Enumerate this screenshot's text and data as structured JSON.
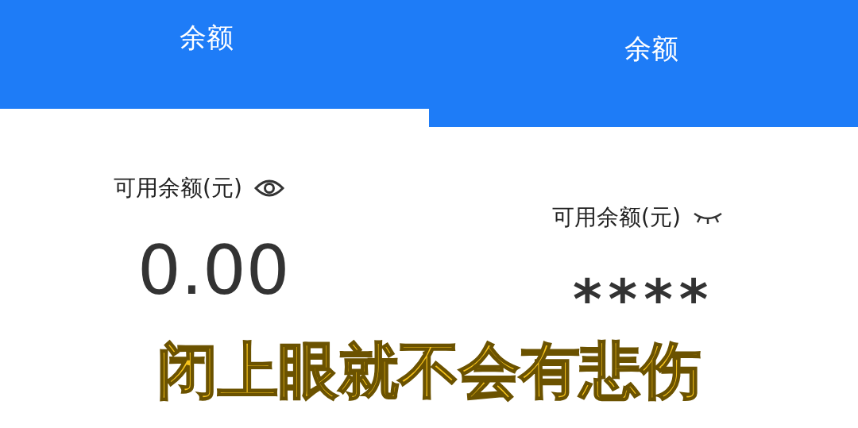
{
  "panels": [
    {
      "title": "余额",
      "balance_label": "可用余额(元)",
      "eye_open": true,
      "amount": "0.00"
    },
    {
      "title": "余额",
      "balance_label": "可用余额(元)",
      "eye_open": false,
      "amount": "****"
    }
  ],
  "caption": "闭上眼就不会有悲伤"
}
